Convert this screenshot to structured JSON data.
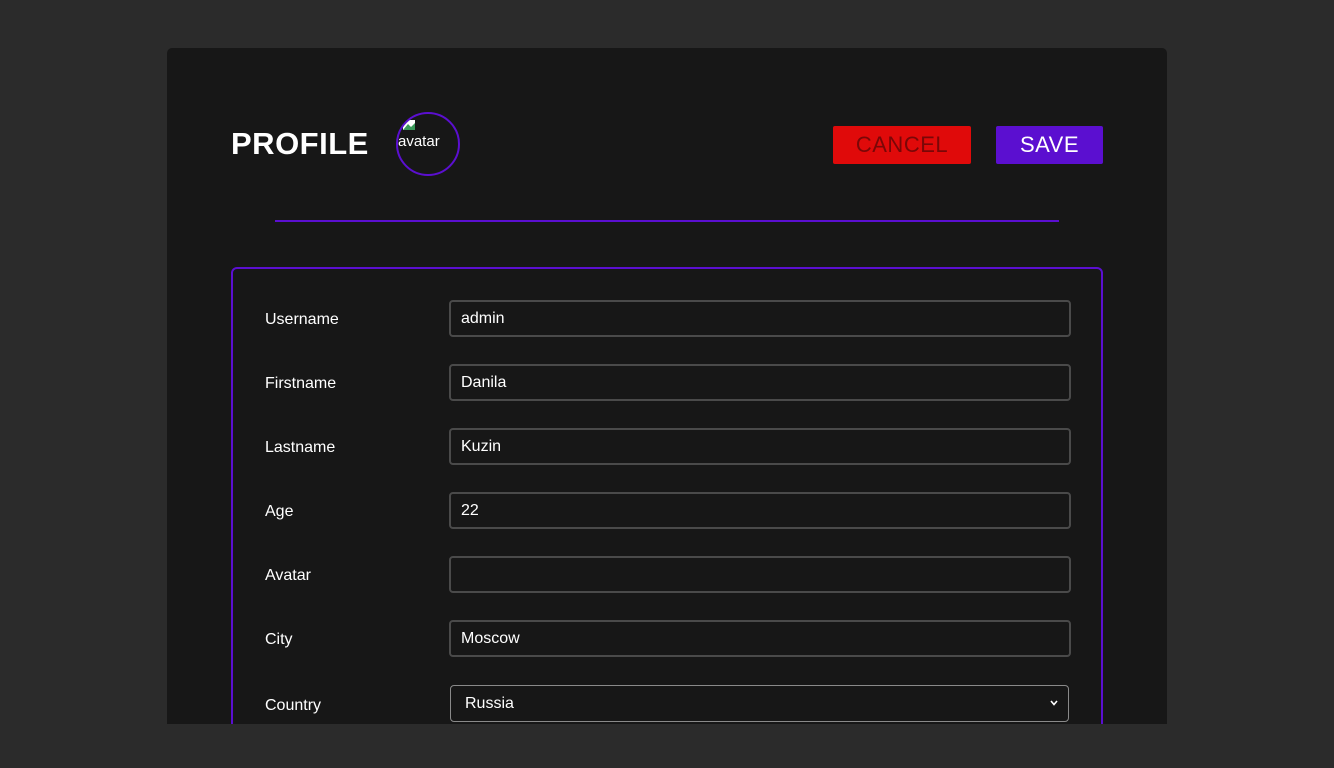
{
  "header": {
    "title": "PROFILE",
    "avatar_alt": "avatar",
    "cancel_label": "CANCEL",
    "save_label": "SAVE"
  },
  "colors": {
    "accent": "#5b0fd0",
    "danger": "#e00a0a",
    "card_bg": "#171717",
    "page_bg": "#2b2b2b"
  },
  "form": {
    "fields": [
      {
        "label": "Username",
        "value": "admin"
      },
      {
        "label": "Firstname",
        "value": "Danila"
      },
      {
        "label": "Lastname",
        "value": "Kuzin"
      },
      {
        "label": "Age",
        "value": "22"
      },
      {
        "label": "Avatar",
        "value": ""
      },
      {
        "label": "City",
        "value": "Moscow"
      }
    ],
    "country": {
      "label": "Country",
      "selected": "Russia"
    }
  }
}
